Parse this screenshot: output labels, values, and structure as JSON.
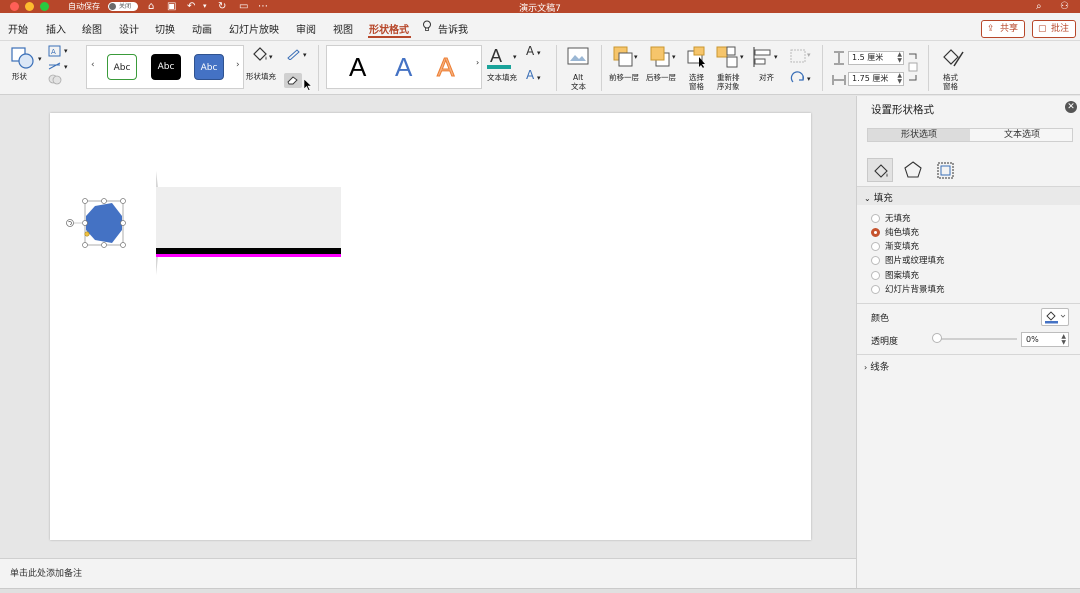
{
  "titlebar": {
    "autosave_label": "自动保存",
    "autosave_state": "关闭",
    "doc_title": "演示文稿7"
  },
  "tabs": [
    "开始",
    "插入",
    "绘图",
    "设计",
    "切换",
    "动画",
    "幻灯片放映",
    "审阅",
    "视图",
    "形状格式"
  ],
  "active_tab": "形状格式",
  "tell_me": "告诉我",
  "share_label": "共享",
  "comment_label": "批注",
  "ribbon": {
    "shapes_label": "形状",
    "style_samples": [
      "Abc",
      "Abc",
      "Abc"
    ],
    "shape_fill_label": "形状填充",
    "wordart_samples": [
      "A",
      "A",
      "A"
    ],
    "text_fill_label": "文本填充",
    "alt_text_label_1": "Alt",
    "alt_text_label_2": "文本",
    "bring_forward_label": "前移一层",
    "send_backward_label": "后移一层",
    "selection_pane_label_1": "选择",
    "selection_pane_label_2": "窗格",
    "reorder_label_1": "重新排",
    "reorder_label_2": "序对象",
    "align_label": "对齐",
    "height_value": "1.5 厘米",
    "width_value": "1.75 厘米",
    "format_pane_label_1": "格式",
    "format_pane_label_2": "窗格"
  },
  "notes_placeholder": "单击此处添加备注",
  "pane": {
    "title": "设置形状格式",
    "segments": [
      "形状选项",
      "文本选项"
    ],
    "fill_section": "填充",
    "fill_options": [
      "无填充",
      "纯色填充",
      "渐变填充",
      "图片或纹理填充",
      "图案填充",
      "幻灯片背景填充"
    ],
    "selected_fill": "纯色填充",
    "color_label": "颜色",
    "transparency_label": "透明度",
    "transparency_value": "0%",
    "transparency_fraction": 0,
    "line_section": "线条"
  },
  "colors": {
    "accent": "#b7472a",
    "shape_fill": "#4472c4",
    "magenta": "#ff00ff"
  }
}
